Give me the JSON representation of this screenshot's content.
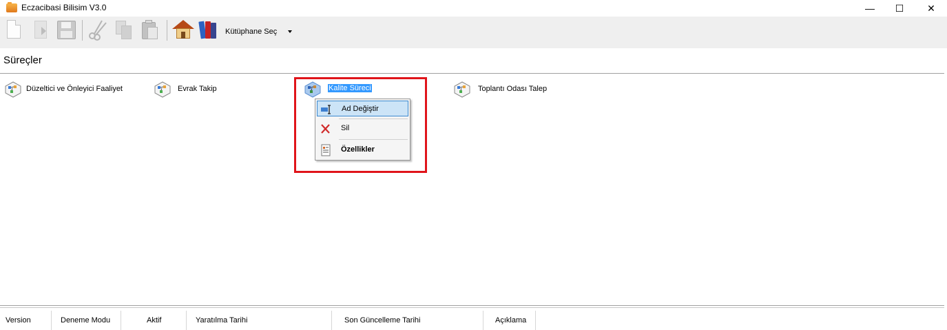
{
  "window": {
    "title": "Eczacibasi Bilisim V3.0",
    "minimize_glyph": "—",
    "maximize_glyph": "☐",
    "close_glyph": "✕"
  },
  "toolbar": {
    "icons": [
      "new-document-icon",
      "open-icon",
      "save-icon",
      "cut-icon",
      "copy-icon",
      "paste-icon",
      "home-icon",
      "library-books-icon"
    ],
    "library_select_label": "Kütüphane Seç"
  },
  "section": {
    "title": "Süreçler"
  },
  "processes": [
    {
      "label": "Düzeltici ve Önleyici Faaliyet",
      "selected": false
    },
    {
      "label": "Evrak Takip",
      "selected": false
    },
    {
      "label": "Kalite Süreci",
      "selected": true
    },
    {
      "label": "Toplantı Odası Talep",
      "selected": false
    }
  ],
  "context_menu": {
    "items": [
      {
        "label": "Ad Değiştir",
        "icon": "rename-icon",
        "hovered": true
      },
      {
        "label": "Sil",
        "icon": "delete-icon",
        "hovered": false
      },
      {
        "label": "Özellikler",
        "icon": "properties-icon",
        "hovered": false
      }
    ]
  },
  "grid": {
    "columns": [
      "Version",
      "Deneme Modu",
      "Aktif",
      "Yaratılma Tarihi",
      "Son Güncelleme Tarihi",
      "Açıklama"
    ]
  },
  "colors": {
    "selection": "#3399ff",
    "highlight_box": "#e0141a",
    "menu_hover": "#cce4f7",
    "toolbar_bg": "#efefef"
  }
}
